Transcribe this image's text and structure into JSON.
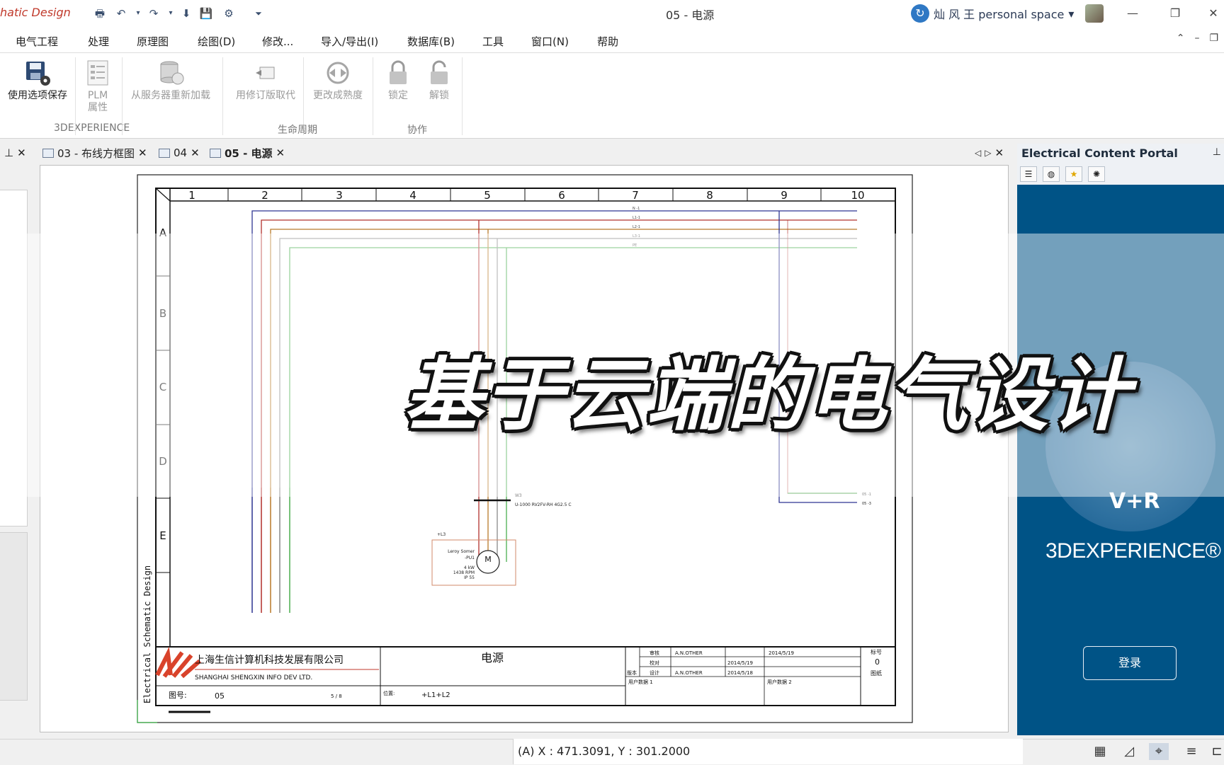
{
  "app": {
    "name": "hatic Design",
    "document_title": "05 - 电源"
  },
  "quick_access": [
    "print-icon",
    "undo-icon",
    "redo-icon",
    "download-icon",
    "save-icon",
    "save-options-icon",
    "customize-icon"
  ],
  "user": {
    "name": "灿 风 王 personal space",
    "dropdown": "▾"
  },
  "window_controls": {
    "minimize": "—",
    "restore": "❐",
    "close": "✕"
  },
  "menu": [
    "电气工程",
    "处理",
    "原理图",
    "绘图(D)",
    "修改...",
    "导入/导出(I)",
    "数据库(B)",
    "工具",
    "窗口(N)",
    "帮助"
  ],
  "ribbon": {
    "groups": [
      {
        "label": "3DEXPERIENCE",
        "buttons": [
          {
            "label": "使用选项保存",
            "enabled": true
          },
          {
            "label": "PLM\n属性",
            "enabled": false
          }
        ]
      },
      {
        "label": "生命周期",
        "buttons": [
          {
            "label": "从服务器重新加载",
            "enabled": false
          },
          {
            "label": "用修订版取代",
            "enabled": false
          },
          {
            "label": "更改成熟度",
            "enabled": false
          }
        ]
      },
      {
        "label": "协作",
        "buttons": [
          {
            "label": "锁定",
            "enabled": false
          },
          {
            "label": "解锁",
            "enabled": false
          }
        ]
      }
    ]
  },
  "tabs": [
    {
      "label": "03 - 布线方框图",
      "active": false
    },
    {
      "label": "04",
      "active": false
    },
    {
      "label": "05 - 电源",
      "active": true
    }
  ],
  "drawing": {
    "columns": [
      "1",
      "2",
      "3",
      "4",
      "5",
      "6",
      "7",
      "8",
      "9",
      "10"
    ],
    "rows": [
      "A",
      "B",
      "C",
      "D",
      "E"
    ],
    "side_title": "Electrical Schematic Design",
    "cable": {
      "name": "W3",
      "spec": "U-1000 RV2FV-RH 4G2.5 C"
    },
    "motor": {
      "location": "+L3",
      "maker": "Leroy Somer",
      "tag": "-PU1",
      "power": "4 kW",
      "speed": "1438 RPM",
      "ip": "IP 55",
      "symbol": "M"
    },
    "bus_labels": [
      "N -1",
      "L1-1",
      "L2-1",
      "L3-1",
      "PE"
    ],
    "outputs": [
      "05 -1",
      "05 -3"
    ],
    "title_block": {
      "company_cn": "上海生信计算机科技发展有限公司",
      "company_en": "SHANGHAI SHENGXIN INFO DEV LTD.",
      "sheet_title": "电源",
      "drawing_no_label": "图号:",
      "drawing_no": "05",
      "page": "5 / 8",
      "location_label": "位置:",
      "location": "+L1+L2",
      "approve": "审核",
      "check": "校对",
      "design": "设计",
      "version": "版本",
      "approver": "A.N.OTHER",
      "designer": "A.N.OTHER",
      "date1": "2014/5/19",
      "date2": "2014/5/19",
      "date3": "2014/5/18",
      "user_data1": "用户数据 1",
      "user_data2": "用户数据 2",
      "label_no": "标号",
      "label_value": "0",
      "drawing_label": "图纸"
    }
  },
  "portal": {
    "title": "Electrical Content Portal",
    "brand": "3DEXPERIENCE®",
    "compass_label": "V+R",
    "login": "登录"
  },
  "status": {
    "coords": "(A) X : 471.3091, Y : 301.2000"
  },
  "caption": "基于云端的电气设计"
}
